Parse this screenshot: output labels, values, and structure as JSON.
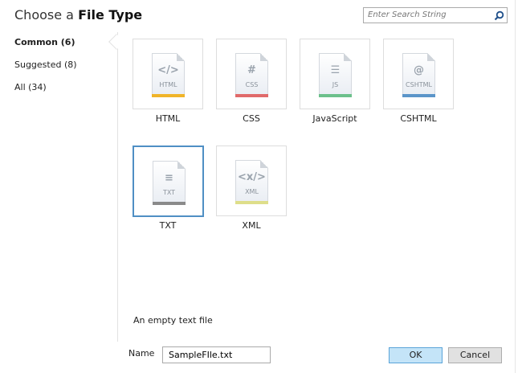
{
  "header": {
    "title_prefix": "Choose a",
    "title_bold": "File Type",
    "search_placeholder": "Enter Search String"
  },
  "categories": [
    {
      "label": "Common (6)",
      "selected": true
    },
    {
      "label": "Suggested (8)"
    },
    {
      "label": "All (34)"
    }
  ],
  "file_types": [
    {
      "label": "HTML",
      "glyph": "</>",
      "ext": "HTML",
      "color": "#f0b429"
    },
    {
      "label": "CSS",
      "glyph": "#",
      "ext": "CSS",
      "color": "#e06a6a"
    },
    {
      "label": "JavaScript",
      "glyph": "☰",
      "ext": "JS",
      "color": "#6cc08b"
    },
    {
      "label": "CSHTML",
      "glyph": "@",
      "ext": "CSHTML",
      "color": "#5b95c9"
    },
    {
      "label": "TXT",
      "glyph": "≡",
      "ext": "TXT",
      "color": "#8a8a8a",
      "selected": true
    },
    {
      "label": "XML",
      "glyph": "<x/>",
      "ext": "XML",
      "color": "#dede8a"
    }
  ],
  "description": "An empty text file",
  "footer": {
    "name_label": "Name",
    "name_value": "SampleFIle.txt",
    "ok_label": "OK",
    "cancel_label": "Cancel"
  }
}
